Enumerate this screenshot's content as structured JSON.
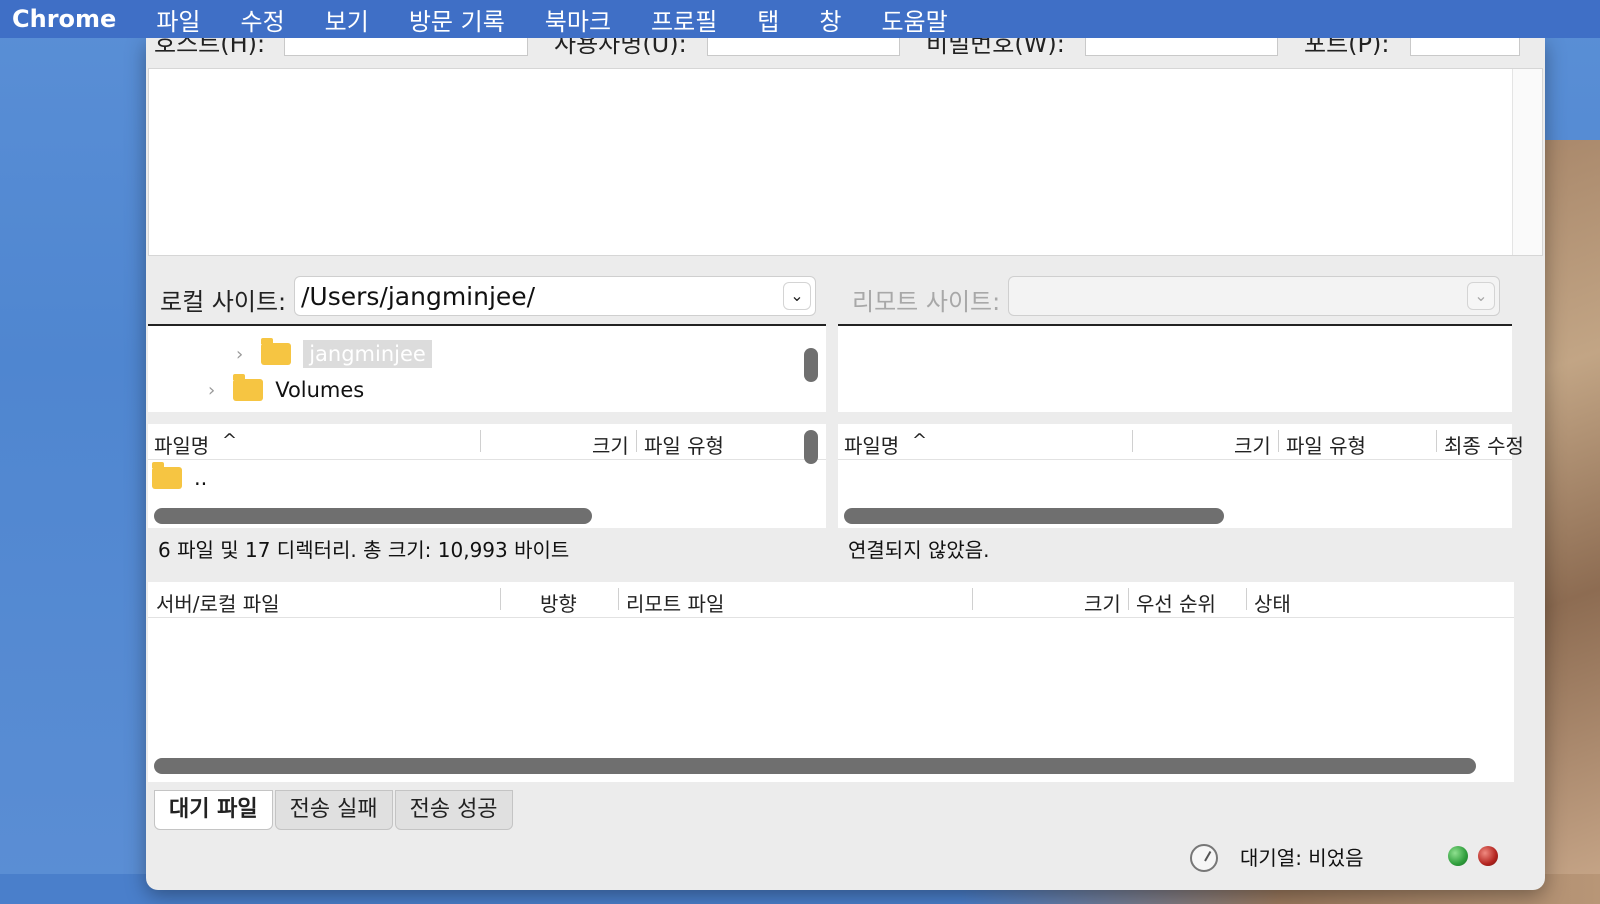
{
  "menubar": {
    "app": "Chrome",
    "items": [
      "파일",
      "수정",
      "보기",
      "방문 기록",
      "북마크",
      "프로필",
      "탭",
      "창",
      "도움말"
    ]
  },
  "quickconnect": {
    "host_label": "호스트(H):",
    "user_label": "사용자명(U):",
    "pass_label": "비밀번호(W):",
    "port_label": "포트(P):"
  },
  "local": {
    "label": "로컬 사이트:",
    "path": "/Users/jangminjee/",
    "tree": [
      {
        "name": "jangminjee",
        "selected": true
      },
      {
        "name": "Volumes",
        "selected": false
      }
    ],
    "columns": [
      "파일명",
      "크기",
      "파일 유형"
    ],
    "rows": [
      ".."
    ],
    "status": "6 파일 및 17 디렉터리. 총 크기: 10,993 바이트"
  },
  "remote": {
    "label": "리모트 사이트:",
    "columns": [
      "파일명",
      "크기",
      "파일 유형",
      "최종 수정"
    ],
    "status": "연결되지 않았음."
  },
  "queue": {
    "columns": [
      "서버/로컬 파일",
      "방향",
      "리모트 파일",
      "크기",
      "우선 순위",
      "상태"
    ],
    "tabs": [
      "대기 파일",
      "전송 실패",
      "전송 성공"
    ],
    "status": "대기열: 비었음"
  },
  "colors": {
    "menubar": "#3f6fc6",
    "led_green": "#2f9e3c",
    "led_red": "#b3241f",
    "folder": "#f6c542"
  }
}
